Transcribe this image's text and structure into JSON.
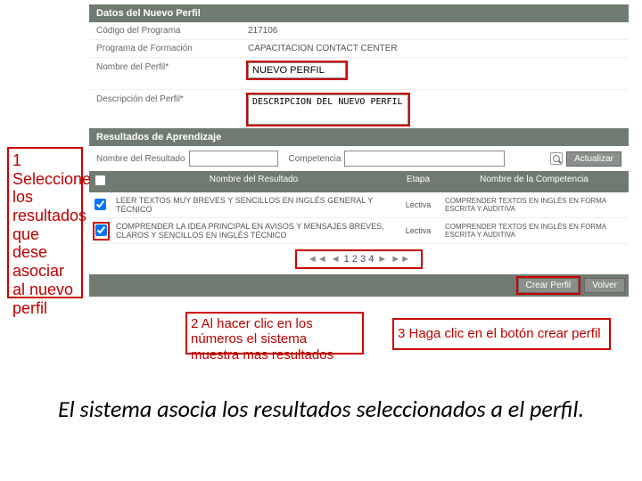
{
  "sections": {
    "datos": "Datos del Nuevo Perfil",
    "resultados": "Resultados de Aprendizaje"
  },
  "form": {
    "codigo_label": "Código del Programa",
    "codigo_value": "217106",
    "programa_label": "Programa de Formación",
    "programa_value": "CAPACITACION CONTACT CENTER",
    "nombre_label": "Nombre del Perfil*",
    "nombre_value": "NUEVO PERFIL",
    "descripcion_label": "Descripción del Perfil*",
    "descripcion_value": "DESCRIPCION DEL NUEVO PERFIL"
  },
  "search": {
    "nombre_label": "Nombre del Resultado",
    "competencia_label": "Competencia",
    "actualizar": "Actualizar"
  },
  "table": {
    "head_nombre": "Nombre del Resultado",
    "head_etapa": "Etapa",
    "head_comp": "Nombre de la Competencia",
    "rows": [
      {
        "nombre": "LEER TEXTOS MUY BREVES Y SENCILLOS EN INGLÉS GENERAL Y TÉCNICO",
        "etapa": "Lectiva",
        "comp": "COMPRENDER TEXTOS EN INGLÉS EN FORMA ESCRITA Y AUDITIVA"
      },
      {
        "nombre": "COMPRENDER LA IDEA PRINCIPAL EN AVISOS Y MENSAJES BREVES, CLAROS Y SENCILLOS EN INGLÉS TÉCNICO",
        "etapa": "Lectiva",
        "comp": "COMPRENDER TEXTOS EN INGLÉS EN FORMA ESCRITA Y AUDITIVA"
      }
    ]
  },
  "pager": {
    "pages": "1 2 3 4",
    "first": "◄◄",
    "prev": "◄",
    "next": "►",
    "last": "►►"
  },
  "buttons": {
    "crear": "Crear Perfil",
    "volver": "Volver"
  },
  "callouts": {
    "c1": "1 Seleccione los resultados que dese asociar al nuevo perfil",
    "c2": "2 Al hacer clic en los números el sistema muestra mas resultados",
    "c3": "3 Haga clic en el botón crear perfil"
  },
  "caption": "El sistema asocia los resultados seleccionados a el perfil."
}
